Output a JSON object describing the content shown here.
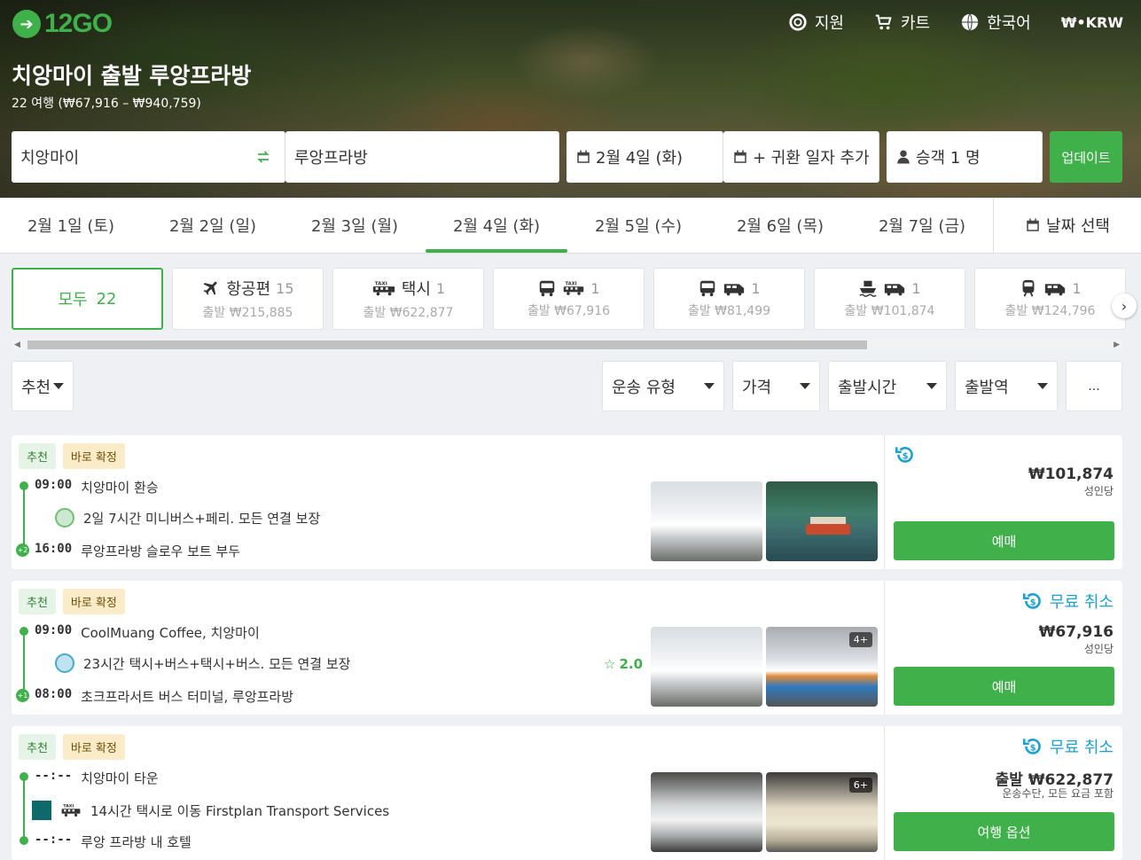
{
  "brand": {
    "logo_text": "12GO"
  },
  "topnav": {
    "support": "지원",
    "cart": "카트",
    "language": "한국어",
    "currency": "₩•KRW"
  },
  "route": {
    "title": "치앙마이 출발 루앙프라방",
    "subtitle": "22 여행 (₩67,916 – ₩940,759)"
  },
  "search": {
    "from": "치앙마이",
    "to": "루앙프라방",
    "date": "2월 4일 (화)",
    "return": "+ 귀환 일자 추가",
    "passengers": "승객 1 명",
    "update": "업데이트"
  },
  "dates": {
    "items": [
      "2월 1일 (토)",
      "2월 2일 (일)",
      "2월 3일 (월)",
      "2월 4일 (화)",
      "2월 5일 (수)",
      "2월 6일 (목)",
      "2월 7일 (금)"
    ],
    "active_index": 3,
    "pick": "날짜 선택"
  },
  "modes": {
    "all": {
      "label": "모두",
      "count": "22"
    },
    "items": [
      {
        "icon": "plane-icon",
        "label": "항공편",
        "count": "15",
        "from": "출발 ₩215,885"
      },
      {
        "icon": "taxi-icon",
        "label": "택시",
        "count": "1",
        "from": "출발 ₩622,877"
      },
      {
        "icon": "bus-taxi-icon",
        "label": "",
        "count": "1",
        "from": "출발 ₩67,916"
      },
      {
        "icon": "bus-van-icon",
        "label": "",
        "count": "1",
        "from": "출발 ₩81,499"
      },
      {
        "icon": "ferry-van-icon",
        "label": "",
        "count": "1",
        "from": "출발 ₩101,874"
      },
      {
        "icon": "train-van-icon",
        "label": "",
        "count": "1",
        "from": "출발 ₩124,796"
      }
    ]
  },
  "filters": {
    "sort": "추천",
    "type": "운송 유형",
    "price": "가격",
    "departure_time": "출발시간",
    "station": "출발역",
    "more": "..."
  },
  "results": [
    {
      "badge1": "추천",
      "badge2": "바로 확정",
      "dep_time": "09:00",
      "dep_place": "치앙마이 환승",
      "trip": "2일 7시간 미니버스+페리. 모든 연결 보장",
      "arr_plus": "+2",
      "arr_time": "16:00",
      "arr_place": "루앙프라방 슬로우 보트 부두",
      "cancel": "",
      "price": "₩101,874",
      "per": "성인당",
      "book": "예매",
      "rating": "",
      "photos_more": ""
    },
    {
      "badge1": "추천",
      "badge2": "바로 확정",
      "dep_time": "09:00",
      "dep_place": "CoolMuang Coffee, 치앙마이",
      "trip": "23시간 택시+버스+택시+버스. 모든 연결 보장",
      "arr_plus": "+1",
      "arr_time": "08:00",
      "arr_place": "초크프라서트 버스 터미널, 루앙프라방",
      "cancel": "무료 취소",
      "price": "₩67,916",
      "per": "성인당",
      "book": "예매",
      "rating": "2.0",
      "photos_more": "4+"
    },
    {
      "badge1": "추천",
      "badge2": "바로 확정",
      "dep_time": "--:--",
      "dep_place": "치앙마이 타운",
      "trip": "14시간 택시로 이동 Firstplan Transport Services",
      "arr_plus": "",
      "arr_time": "--:--",
      "arr_place": "루앙 프라방 내 호텔",
      "cancel": "무료 취소",
      "price": "출발 ₩622,877",
      "per": "운송수단, 모든 요금 포함",
      "book": "여행 옵션",
      "rating": "",
      "photos_more": "6+"
    }
  ],
  "colors": {
    "accent": "#3fb04a",
    "cancel": "#1ba1d1",
    "badge_rec_bg": "#e6f4e7",
    "badge_confirm_bg": "#fbecc9"
  }
}
